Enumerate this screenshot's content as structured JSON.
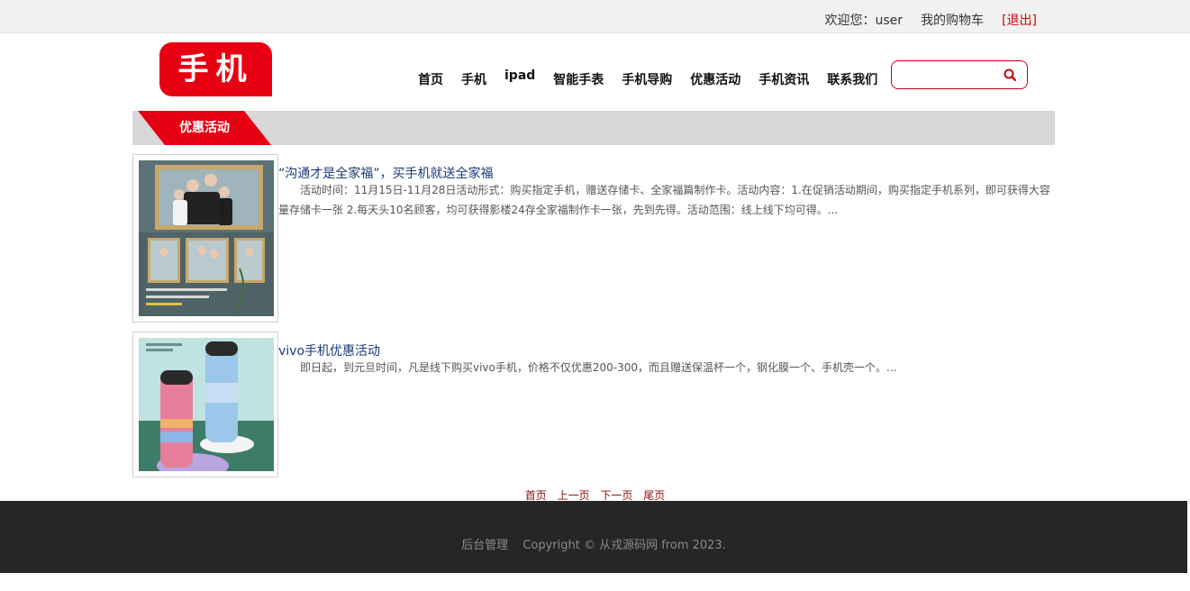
{
  "topbar": {
    "welcome": "欢迎您：user",
    "cart": "我的购物车",
    "logout": "[退出]"
  },
  "logo": {
    "text": "手机"
  },
  "nav": [
    "首页",
    "手机",
    "ipad",
    "智能手表",
    "手机导购",
    "优惠活动",
    "手机资讯",
    "联系我们"
  ],
  "search": {
    "placeholder": ""
  },
  "section": {
    "title": "优惠活动"
  },
  "articles": [
    {
      "title": "“沟通才是全家福”，买手机就送全家福",
      "desc": "活动时间：11月15日-11月28日活动形式：购买指定手机，赠送存储卡、全家福篇制作卡。活动内容：1.在促销活动期间，购买指定手机系列，即可获得大容量存储卡一张 2.每天头10名顾客，均可获得影楼24存全家福制作卡一张，先到先得。活动范围：线上线下均可得。..."
    },
    {
      "title": "vivo手机优惠活动",
      "desc": "即日起，到元旦时间，凡是线下购买vivo手机，价格不仅优惠200-300，而且赠送保温杯一个，钢化膜一个、手机壳一个。..."
    }
  ],
  "pager": [
    "首页",
    "上一页",
    "下一页",
    "尾页"
  ],
  "footer": {
    "admin": "后台管理",
    "copyright": "Copyright © 从戎源码网 from 2023."
  },
  "colors": {
    "brand": "#e60012",
    "footer": "#262626",
    "bar": "#d9d8d9"
  }
}
